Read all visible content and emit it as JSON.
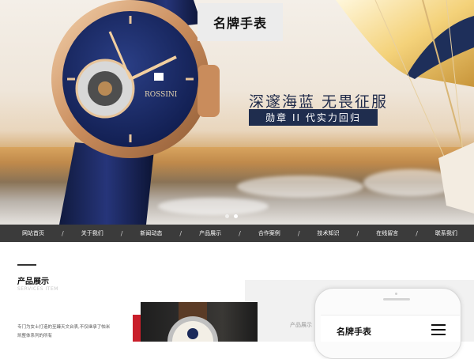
{
  "hero": {
    "brand": "名牌手表",
    "slogan": "深邃海蓝 无畏征服",
    "tagline": "勋章 II 代实力回归",
    "watch_brand_text": "ROSSINI",
    "carousel": {
      "count": 2,
      "active_index": 1
    }
  },
  "nav": {
    "items": [
      "网站首页",
      "关于我们",
      "新闻动态",
      "产品展示",
      "合作案例",
      "技术知识",
      "在线留言",
      "联系我们"
    ],
    "separator": "/"
  },
  "section": {
    "title": "产品展示",
    "subtitle": "SERVICES ITEM",
    "description": "专门为女士打造的至臻天文台表,不仅继承了帕米凯整体系列的所有"
  },
  "panel": {
    "label": "产品展示"
  },
  "phone": {
    "title": "名牌手表",
    "menu_icon": "hamburger-menu-icon"
  },
  "colors": {
    "nav_bg": "#3b3b3b",
    "tagline_bg": "#1f2d4e",
    "accent_red": "#c91f2b"
  }
}
